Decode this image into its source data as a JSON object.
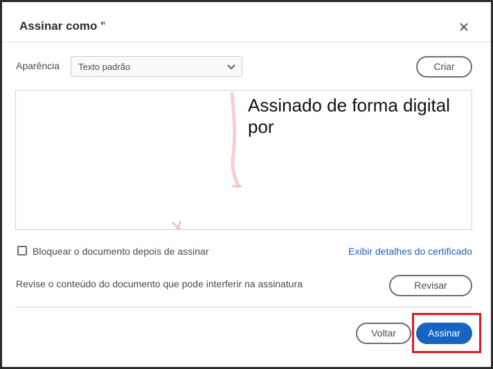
{
  "dialog": {
    "title": "Assinar como \"",
    "close_icon": "close-icon"
  },
  "appearance": {
    "label": "Aparência",
    "selected": "Texto padrão",
    "chevron_icon": "chevron-down-icon",
    "create_button": "Criar"
  },
  "preview": {
    "line1": "Assinado de forma digital",
    "line2": "por"
  },
  "options": {
    "lock_checkbox_label": "Bloquear o documento depois de assinar",
    "lock_checked": false,
    "cert_link": "Exibir detalhes do certificado"
  },
  "review": {
    "text": "Revise o conteúdo do documento que pode interferir na assinatura",
    "button": "Revisar"
  },
  "footer": {
    "back_button": "Voltar",
    "sign_button": "Assinar"
  },
  "colors": {
    "accent": "#1565c0",
    "link": "#1e62b3",
    "highlight": "#e0181f"
  }
}
